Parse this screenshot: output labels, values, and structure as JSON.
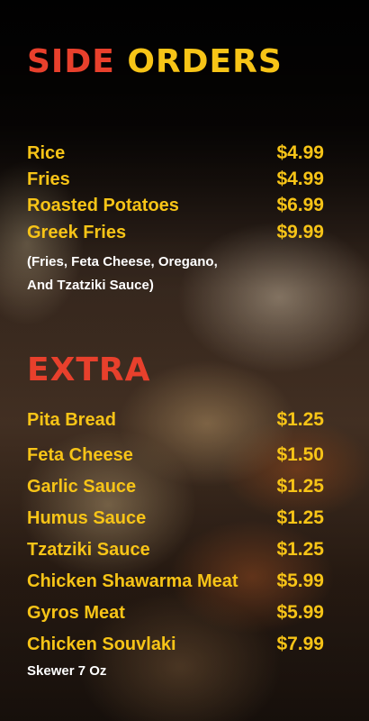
{
  "side_orders": {
    "title_word1": "SIDE",
    "title_word2": "ORDERS",
    "items": [
      {
        "name": "Rice",
        "price": "$4.99"
      },
      {
        "name": "Fries",
        "price": "$4.99"
      },
      {
        "name": "Roasted Potatoes",
        "price": "$6.99"
      },
      {
        "name": "Greek Fries",
        "price": "$9.99"
      }
    ],
    "note_line1": "(Fries, Feta Cheese, Oregano,",
    "note_line2": "And Tzatziki Sauce)"
  },
  "extra": {
    "title": "EXTRA",
    "items": [
      {
        "name": "Pita Bread",
        "price": "$1.25"
      },
      {
        "name": "Feta Cheese",
        "price": "$1.50"
      },
      {
        "name": "Garlic Sauce",
        "price": "$1.25"
      },
      {
        "name": "Humus Sauce",
        "price": "$1.25"
      },
      {
        "name": "Tzatziki Sauce",
        "price": "$1.25"
      },
      {
        "name": "Chicken Shawarma Meat",
        "price": "$5.99"
      },
      {
        "name": "Gyros Meat",
        "price": "$5.99"
      },
      {
        "name": "Chicken Souvlaki",
        "price": "$7.99"
      }
    ],
    "note": "Skewer  7 Oz"
  },
  "colors": {
    "title_red": "#e8402c",
    "title_yellow": "#f7c417",
    "item_text": "#f7c417",
    "note_text": "#ffffff"
  }
}
